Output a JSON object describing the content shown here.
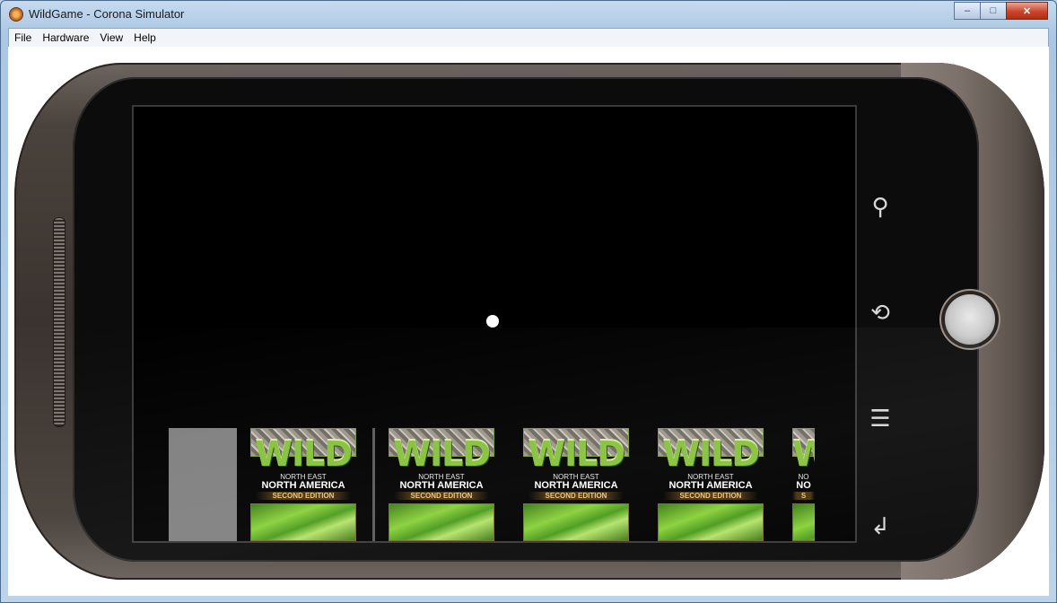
{
  "window": {
    "title": "WildGame - Corona Simulator",
    "controls": {
      "minimize": "–",
      "maximize": "□",
      "close": "✕"
    }
  },
  "menu": {
    "items": [
      {
        "label": "File"
      },
      {
        "label": "Hardware"
      },
      {
        "label": "View"
      },
      {
        "label": "Help"
      }
    ]
  },
  "covers": [
    {
      "title": "WILD",
      "region": "NORTH EAST",
      "area": "NORTH AMERICA",
      "edition": "SECOND EDITION"
    },
    {
      "title": "WILD",
      "region": "NORTH EAST",
      "area": "NORTH AMERICA",
      "edition": "SECOND EDITION"
    },
    {
      "title": "WILD",
      "region": "NORTH EAST",
      "area": "NORTH AMERICA",
      "edition": "SECOND EDITION"
    },
    {
      "title": "WILD",
      "region": "NORTH EAST",
      "area": "NORTH AMERICA",
      "edition": "SECOND EDITION"
    },
    {
      "title": "W",
      "region": "NO",
      "area": "NO",
      "edition": "S"
    }
  ],
  "device_buttons": {
    "search": "⚲",
    "back": "⟲",
    "menu": "☰",
    "return": "↲"
  },
  "colors": {
    "screen": "#000000",
    "accent_green": "#86c23c"
  }
}
